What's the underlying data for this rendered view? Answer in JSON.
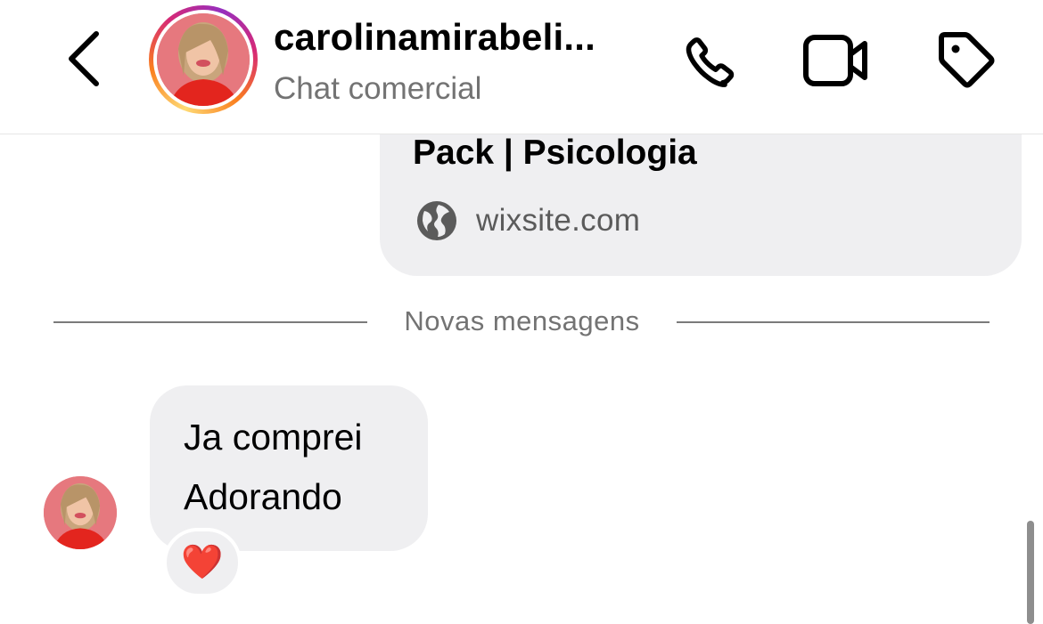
{
  "header": {
    "title": "carolinamirabeli...",
    "subtitle": "Chat comercial",
    "back_icon": "chevron-left-icon",
    "call_icon": "phone-icon",
    "video_icon": "video-camera-icon",
    "tag_icon": "tag-icon",
    "story_ring_colors": [
      "#feda75",
      "#fa7e1e",
      "#d62976",
      "#962fbf"
    ]
  },
  "link_preview": {
    "title": "Pack | Psicologia",
    "domain": "wixsite.com",
    "domain_icon": "globe-icon"
  },
  "separator": {
    "label": "Novas mensagens"
  },
  "messages": [
    {
      "direction": "incoming",
      "lines": [
        "Ja comprei",
        "Adorando"
      ],
      "reaction": "❤️"
    }
  ],
  "colors": {
    "bubble_bg": "#efeff1",
    "secondary_text": "#737373",
    "reaction_heart": "#e0131b"
  }
}
